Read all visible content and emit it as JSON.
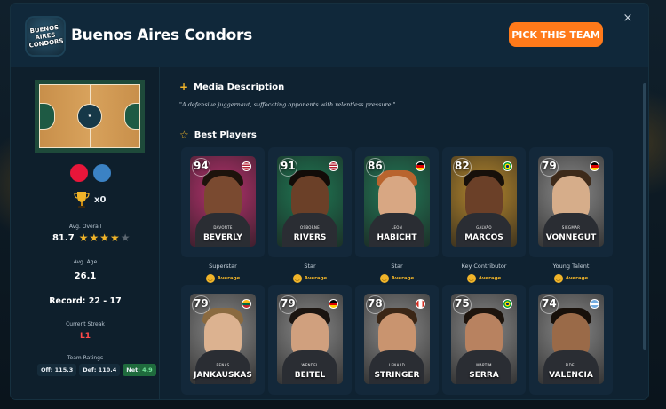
{
  "team": {
    "name": "Buenos Aires Condors",
    "logo_text": "BUENOS AIRES CONDORS",
    "pick_label": "PICK THIS TEAM",
    "close_icon": "×",
    "colors": [
      "#e8163a",
      "#3b82c4"
    ]
  },
  "summary": {
    "trophies": "x0",
    "avg_overall_label": "Avg. Overall",
    "avg_overall": "81.7",
    "avg_overall_stars": 3.5,
    "avg_age_label": "Avg. Age",
    "avg_age": "26.1",
    "record": "Record: 22 - 17",
    "streak_label": "Current Streak",
    "streak": "L1",
    "ratings_label": "Team Ratings",
    "off_label": "Off:",
    "off": "115.3",
    "def_label": "Def:",
    "def": "110.4",
    "net_label": "Net:",
    "net": "4.9"
  },
  "media": {
    "title": "Media Description",
    "quote": "\"A defensive juggernaut, suffocating opponents with relentless pressure.\""
  },
  "best_players": {
    "title": "Best Players",
    "players": [
      {
        "rating": "94",
        "first": "DAVONTE",
        "last": "BEVERLY",
        "role": "Superstar",
        "badge": "Average",
        "bg": "#b8326f",
        "skin": "#7a4a30",
        "hair": "#1d130c",
        "flag": "usa"
      },
      {
        "rating": "91",
        "first": "OSBORNE",
        "last": "RIVERS",
        "role": "Star",
        "badge": "Average",
        "bg": "#1f7a55",
        "skin": "#6b4028",
        "hair": "#120c08",
        "flag": "usa"
      },
      {
        "rating": "86",
        "first": "LEON",
        "last": "HABICHT",
        "role": "Star",
        "badge": "Average",
        "bg": "#237a58",
        "skin": "#d8a783",
        "hair": "#b9642e",
        "flag": "germany"
      },
      {
        "rating": "82",
        "first": "GALVÃO",
        "last": "MARCOS",
        "role": "Key Contributor",
        "badge": "Average",
        "bg": "#b98a2e",
        "skin": "#6b4028",
        "hair": "#17100a",
        "flag": "brazil"
      },
      {
        "rating": "79",
        "first": "SIEGMAR",
        "last": "VONNEGUT",
        "role": "Young Talent",
        "badge": "Average",
        "bg": "#8d8d8d",
        "skin": "#d6ad8a",
        "hair": "#3d2a1a",
        "flag": "germany"
      },
      {
        "rating": "79",
        "first": "BENAS",
        "last": "JANKAUSKAS",
        "role": "",
        "badge": "",
        "bg": "#8a8a8a",
        "skin": "#dcb290",
        "hair": "#8a6a40",
        "flag": "lithuania"
      },
      {
        "rating": "79",
        "first": "WENDEL",
        "last": "BEITEL",
        "role": "",
        "badge": "",
        "bg": "#8a8a8a",
        "skin": "#d0a07e",
        "hair": "#1a1410",
        "flag": "germany"
      },
      {
        "rating": "78",
        "first": "LENARD",
        "last": "STRINGER",
        "role": "",
        "badge": "",
        "bg": "#8a8a8a",
        "skin": "#c9946f",
        "hair": "#3a2616",
        "flag": "canada"
      },
      {
        "rating": "75",
        "first": "MARTIM",
        "last": "SERRA",
        "role": "",
        "badge": "",
        "bg": "#8a8a8a",
        "skin": "#b88260",
        "hair": "#1d140d",
        "flag": "brazil"
      },
      {
        "rating": "74",
        "first": "FIDEL",
        "last": "VALENCIA",
        "role": "",
        "badge": "",
        "bg": "#8a8a8a",
        "skin": "#9a6a48",
        "hair": "#17100a",
        "flag": "argentina"
      }
    ]
  }
}
